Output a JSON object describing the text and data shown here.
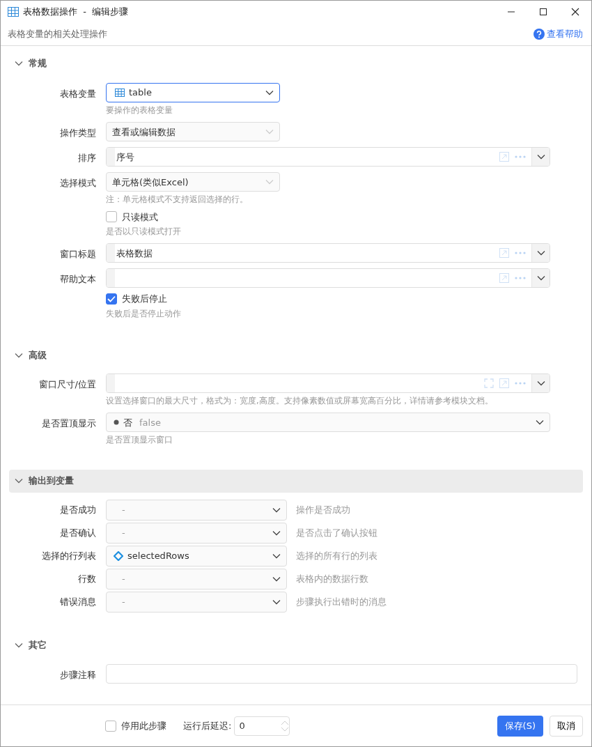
{
  "window": {
    "title": "表格数据操作  -  编辑步骤"
  },
  "header": {
    "subtitle": "表格变量的相关处理操作",
    "help_link": "查看帮助"
  },
  "sections": [
    {
      "title": "常规",
      "expanded": true,
      "highlighted": false,
      "fields": [
        {
          "kind": "table_select",
          "label": "表格变量",
          "value": "table",
          "hint": "要操作的表格变量",
          "focused": true
        },
        {
          "kind": "select",
          "label": "操作类型",
          "value": "查看或编辑数据",
          "focused": false
        },
        {
          "kind": "expr",
          "label": "排序",
          "value": "序号"
        },
        {
          "kind": "select",
          "label": "选择模式",
          "value": "单元格(类似Excel)",
          "hint": "注：单元格模式不支持返回选择的行。",
          "focused": false
        },
        {
          "kind": "check",
          "label": "只读模式",
          "checked": false,
          "hint": "是否以只读模式打开"
        },
        {
          "kind": "expr",
          "label": "窗口标题",
          "value": "表格数据"
        },
        {
          "kind": "expr",
          "label": "帮助文本"
        },
        {
          "kind": "check",
          "label": "失败后停止",
          "checked": true,
          "hint": "失败后是否停止动作"
        }
      ]
    },
    {
      "title": "高级",
      "expanded": true,
      "highlighted": false,
      "fields": [
        {
          "kind": "expr",
          "label": "窗口尺寸/位置",
          "fullscreen": true,
          "hint": "设置选择窗口的最大尺寸，格式为：宽度,高度。支持像素数值或屏幕宽高百分比，详情请参考模块文档。"
        },
        {
          "kind": "bool",
          "label": "是否置顶显示",
          "value": "否",
          "literal": "false",
          "hint": "是否置顶显示窗口"
        }
      ]
    },
    {
      "title": "输出到变量",
      "expanded": true,
      "highlighted": true,
      "fields": [
        {
          "kind": "output",
          "label": "是否成功",
          "placeholder": "-",
          "hint": "操作是否成功"
        },
        {
          "kind": "output",
          "label": "是否确认",
          "placeholder": "-",
          "hint": "是否点击了确认按钮"
        },
        {
          "kind": "variable_output",
          "label": "选择的行列表",
          "value": "selectedRows",
          "hint": "选择的所有行的列表"
        },
        {
          "kind": "output",
          "label": "行数",
          "placeholder": "-",
          "hint": "表格内的数据行数"
        },
        {
          "kind": "output",
          "label": "错误消息",
          "placeholder": "-",
          "hint": "步骤执行出错时的消息"
        }
      ]
    },
    {
      "title": "其它",
      "expanded": true,
      "highlighted": false,
      "fields": [
        {
          "kind": "text",
          "label": "步骤注释"
        }
      ]
    }
  ],
  "footer": {
    "disable": {
      "label": "停用此步骤",
      "checked": false
    },
    "delay_label": "运行后延迟:",
    "delay_value": "0",
    "save": "保存(S)",
    "cancel": "取消"
  }
}
